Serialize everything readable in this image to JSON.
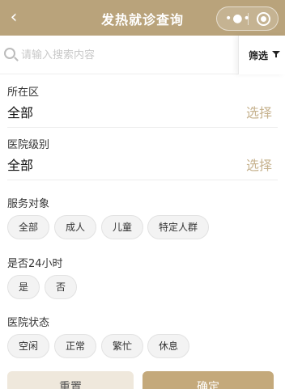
{
  "header": {
    "title": "发热就诊查询",
    "back_icon": "chevron-left-icon",
    "more_icon": "more-dots-icon",
    "close_icon": "target-icon"
  },
  "search": {
    "placeholder": "请输入搜索内容",
    "value": ""
  },
  "filter": {
    "label": "筛选",
    "icon": "filter-icon"
  },
  "district": {
    "label": "所在区",
    "value": "全部",
    "action": "选择"
  },
  "level": {
    "label": "医院级别",
    "value": "全部",
    "action": "选择"
  },
  "service": {
    "title": "服务对象",
    "options": [
      "全部",
      "成人",
      "儿童",
      "特定人群"
    ]
  },
  "allday": {
    "title": "是否24小时",
    "options": [
      "是",
      "否"
    ]
  },
  "status": {
    "title": "医院状态",
    "options": [
      "空闲",
      "正常",
      "繁忙",
      "休息"
    ]
  },
  "actions": {
    "reset": "重置",
    "confirm": "确定"
  },
  "colors": {
    "header": "#b9a37b",
    "accent": "#c6b28e",
    "confirm": "#c4a97b"
  }
}
